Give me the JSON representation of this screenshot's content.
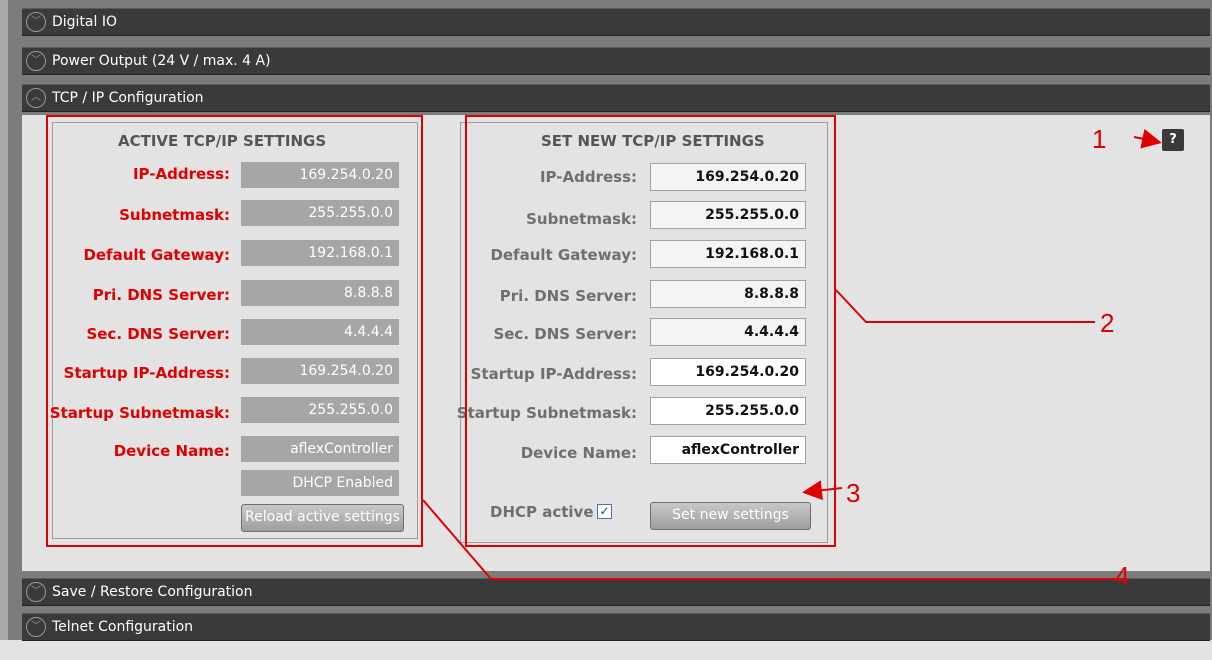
{
  "sections": {
    "digital_io": "Digital IO",
    "power_output": "Power Output (24 V / max. 4 A)",
    "tcp_ip": "TCP / IP Configuration",
    "save_restore": "Save / Restore Configuration",
    "telnet": "Telnet Configuration"
  },
  "active": {
    "title": "ACTIVE TCP/IP SETTINGS",
    "labels": {
      "ip": "IP-Address:",
      "subnet": "Subnetmask:",
      "gateway": "Default Gateway:",
      "dns1": "Pri. DNS Server:",
      "dns2": "Sec. DNS Server:",
      "startup_ip": "Startup IP-Address:",
      "startup_subnet": "Startup Subnetmask:",
      "device_name": "Device Name:"
    },
    "values": {
      "ip": "169.254.0.20",
      "subnet": "255.255.0.0",
      "gateway": "192.168.0.1",
      "dns1": "8.8.8.8",
      "dns2": "4.4.4.4",
      "startup_ip": "169.254.0.20",
      "startup_subnet": "255.255.0.0",
      "device_name": "aflexController",
      "dhcp_status": "DHCP Enabled"
    },
    "reload_button": "Reload active settings"
  },
  "new_settings": {
    "title": "SET NEW TCP/IP SETTINGS",
    "labels": {
      "ip": "IP-Address:",
      "subnet": "Subnetmask:",
      "gateway": "Default Gateway:",
      "dns1": "Pri. DNS Server:",
      "dns2": "Sec. DNS Server:",
      "startup_ip": "Startup IP-Address:",
      "startup_subnet": "Startup Subnetmask:",
      "device_name": "Device Name:"
    },
    "values": {
      "ip": "169.254.0.20",
      "subnet": "255.255.0.0",
      "gateway": "192.168.0.1",
      "dns1": "8.8.8.8",
      "dns2": "4.4.4.4",
      "startup_ip": "169.254.0.20",
      "startup_subnet": "255.255.0.0",
      "device_name": "aflexController"
    },
    "dhcp_label": "DHCP active",
    "dhcp_checked": "✓",
    "set_button": "Set new settings"
  },
  "help_button": "?",
  "callouts": {
    "c1": "1",
    "c2": "2",
    "c3": "3",
    "c4": "4"
  },
  "colors": {
    "annotation": "#e00000",
    "header_bg": "#3a3a3a",
    "panel_bg": "#e3e3e3"
  }
}
